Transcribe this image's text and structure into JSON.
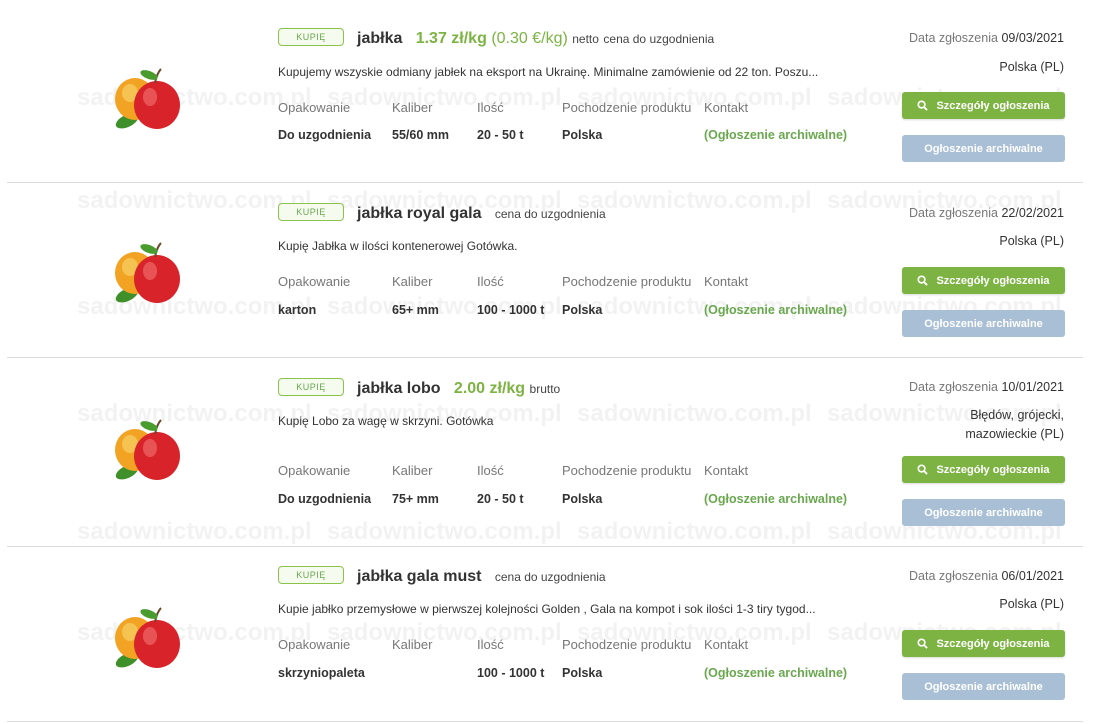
{
  "colors": {
    "accent_green": "#7cb342",
    "archived_button": "#a9bfd6",
    "price_green": "#7cb342"
  },
  "watermark": "sadownictwo.com.pl",
  "column_labels": {
    "packaging": "Opakowanie",
    "caliber": "Kaliber",
    "quantity": "Ilość",
    "origin": "Pochodzenie produktu",
    "contact": "Kontakt"
  },
  "date_label": "Data zgłoszenia",
  "details_button": "Szczegóły ogłoszenia",
  "archived_button": "Ogłoszenie archiwalne",
  "listings": [
    {
      "tag": "KUPIĘ",
      "title": "jabłka",
      "price": "1.37 zł/kg",
      "price_eur": "(0.30 €/kg)",
      "price_note": "netto",
      "extra_note": "cena do uzgodnienia",
      "description": "Kupujemy wszyskie odmiany jabłek na eksport na Ukrainę. Minimalne zamówienie od 22 ton. Poszu...",
      "packaging": "Do uzgodnienia",
      "caliber": "55/60 mm",
      "quantity": "20 - 50 t",
      "origin": "Polska",
      "contact": "(Ogłoszenie archiwalne)",
      "date": "09/03/2021",
      "location": "Polska (PL)"
    },
    {
      "tag": "KUPIĘ",
      "title": "jabłka royal gala",
      "price": "",
      "price_eur": "",
      "price_note": "",
      "extra_note": "cena do uzgodnienia",
      "description": "Kupię Jabłka w ilości kontenerowej Gotówka.",
      "packaging": "karton",
      "caliber": "65+ mm",
      "quantity": "100 - 1000 t",
      "origin": "Polska",
      "contact": "(Ogłoszenie archiwalne)",
      "date": "22/02/2021",
      "location": "Polska (PL)"
    },
    {
      "tag": "KUPIĘ",
      "title": "jabłka lobo",
      "price": "2.00 zł/kg",
      "price_eur": "",
      "price_note": "brutto",
      "extra_note": "",
      "description": "Kupię Lobo za wagę w skrzyni. Gotówka",
      "packaging": "Do uzgodnienia",
      "caliber": "75+ mm",
      "quantity": "20 - 50 t",
      "origin": "Polska",
      "contact": "(Ogłoszenie archiwalne)",
      "date": "10/01/2021",
      "location_line1": "Błędów, grójecki,",
      "location_line2": "mazowieckie (PL)"
    },
    {
      "tag": "KUPIĘ",
      "title": "jabłka gala must",
      "price": "",
      "price_eur": "",
      "price_note": "",
      "extra_note": "cena do uzgodnienia",
      "description": "Kupie jabłko przemysłowe w pierwszej kolejności Golden , Gala na kompot i sok ilości 1-3 tiry tygod...",
      "packaging": "skrzyniopaleta",
      "caliber": "",
      "quantity": "100 - 1000 t",
      "origin": "Polska",
      "contact": "(Ogłoszenie archiwalne)",
      "date": "06/01/2021",
      "location": "Polska (PL)"
    }
  ]
}
